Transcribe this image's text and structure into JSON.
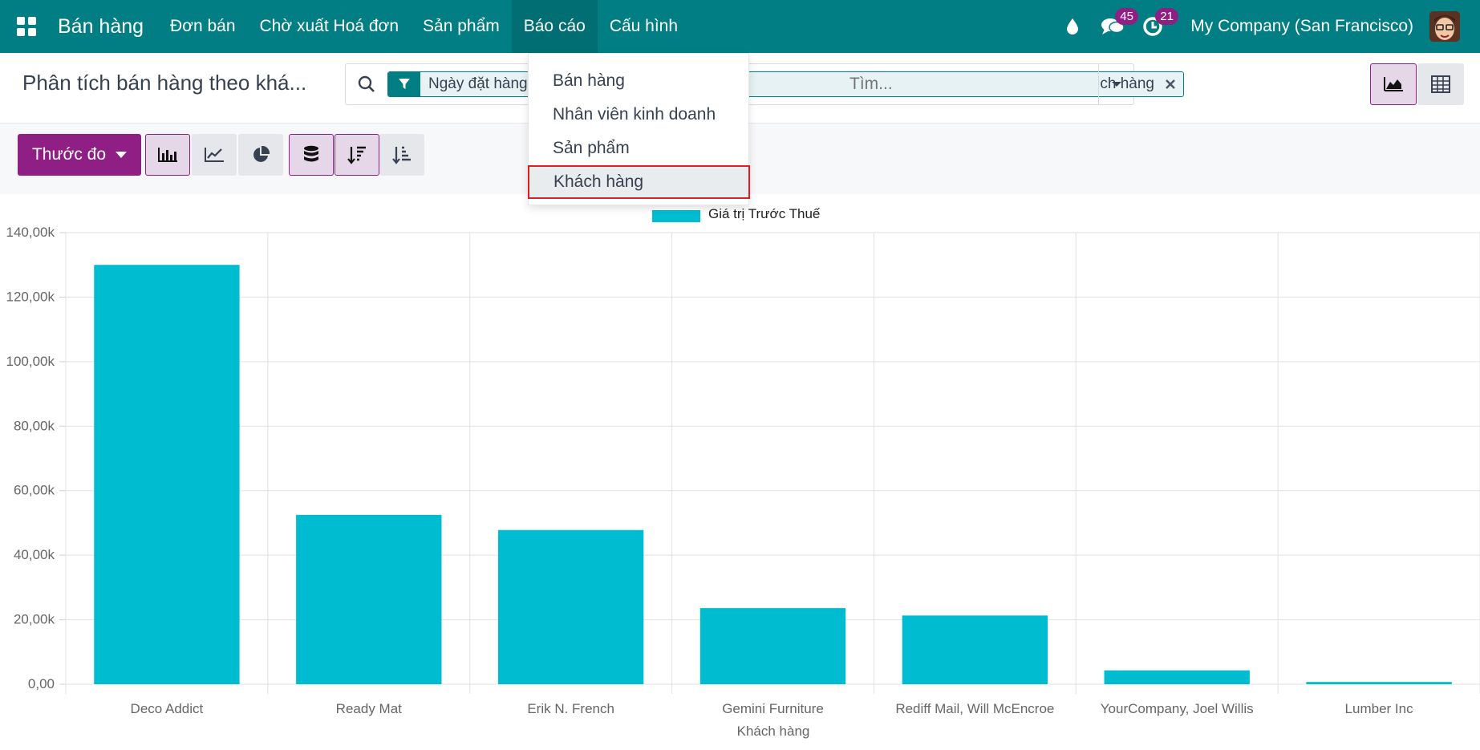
{
  "navbar": {
    "brand": "Bán hàng",
    "menu": [
      "Đơn bán",
      "Chờ xuất Hoá đơn",
      "Sản phẩm",
      "Báo cáo",
      "Cấu hình"
    ],
    "messages_count": "45",
    "activities_count": "21",
    "company": "My Company (San Francisco)"
  },
  "control": {
    "breadcrumb": "Phân tích bán hàng theo khá...",
    "facet1_label": "Ngày đặt hàng",
    "facet2_label": "ch hàng",
    "search_placeholder": "Tìm..."
  },
  "toolbar": {
    "measure_label": "Thước đo"
  },
  "dropdown": {
    "items": [
      "Bán hàng",
      "Nhân viên kinh doanh",
      "Sản phẩm",
      "Khách hàng"
    ],
    "selected_index": 3
  },
  "colors": {
    "navbar": "#017e84",
    "accent": "#8f1f84",
    "bar": "#00bcd0"
  },
  "chart_data": {
    "type": "bar",
    "categories": [
      "Deco Addict",
      "Ready Mat",
      "Erik N. French",
      "Gemini Furniture",
      "Rediff Mail, Will McEncroe",
      "YourCompany, Joel Willis",
      "Lumber Inc"
    ],
    "series": [
      {
        "name": "Giá trị Trước Thuế",
        "values": [
          130000,
          52500,
          47800,
          23600,
          21300,
          4300,
          700
        ]
      }
    ],
    "xlabel": "Khách hàng",
    "ylabel": "",
    "ylim": [
      0,
      140000
    ],
    "yticks": [
      "0,00",
      "20,00k",
      "40,00k",
      "60,00k",
      "80,00k",
      "100,00k",
      "120,00k",
      "140,00k"
    ],
    "grid": true,
    "legend": "top-center"
  }
}
